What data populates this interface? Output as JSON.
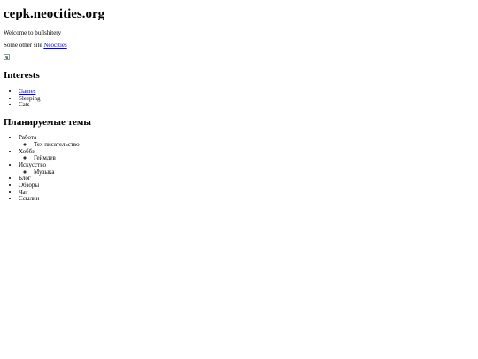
{
  "header": {
    "title": "cepk.neocities.org"
  },
  "intro": {
    "welcome": "Welcome to bullshitery",
    "other_prefix": "Some other site ",
    "other_link": "Neocities"
  },
  "image": {
    "alt": ""
  },
  "interests": {
    "heading": "Interests",
    "items": [
      {
        "label": "Games",
        "link": true
      },
      {
        "label": "Sleeping",
        "link": false
      },
      {
        "label": "Cats",
        "link": false
      }
    ]
  },
  "planned": {
    "heading": "Планируемые темы",
    "items": [
      {
        "label": "Работа",
        "children": [
          "Тех писательство"
        ]
      },
      {
        "label": "Хобби",
        "children": [
          "Геймдев"
        ]
      },
      {
        "label": "Искусство",
        "children": [
          "Музыка"
        ]
      },
      {
        "label": "Блог"
      },
      {
        "label": "Обзоры"
      },
      {
        "label": "Чат"
      },
      {
        "label": "Ссылки"
      }
    ]
  }
}
